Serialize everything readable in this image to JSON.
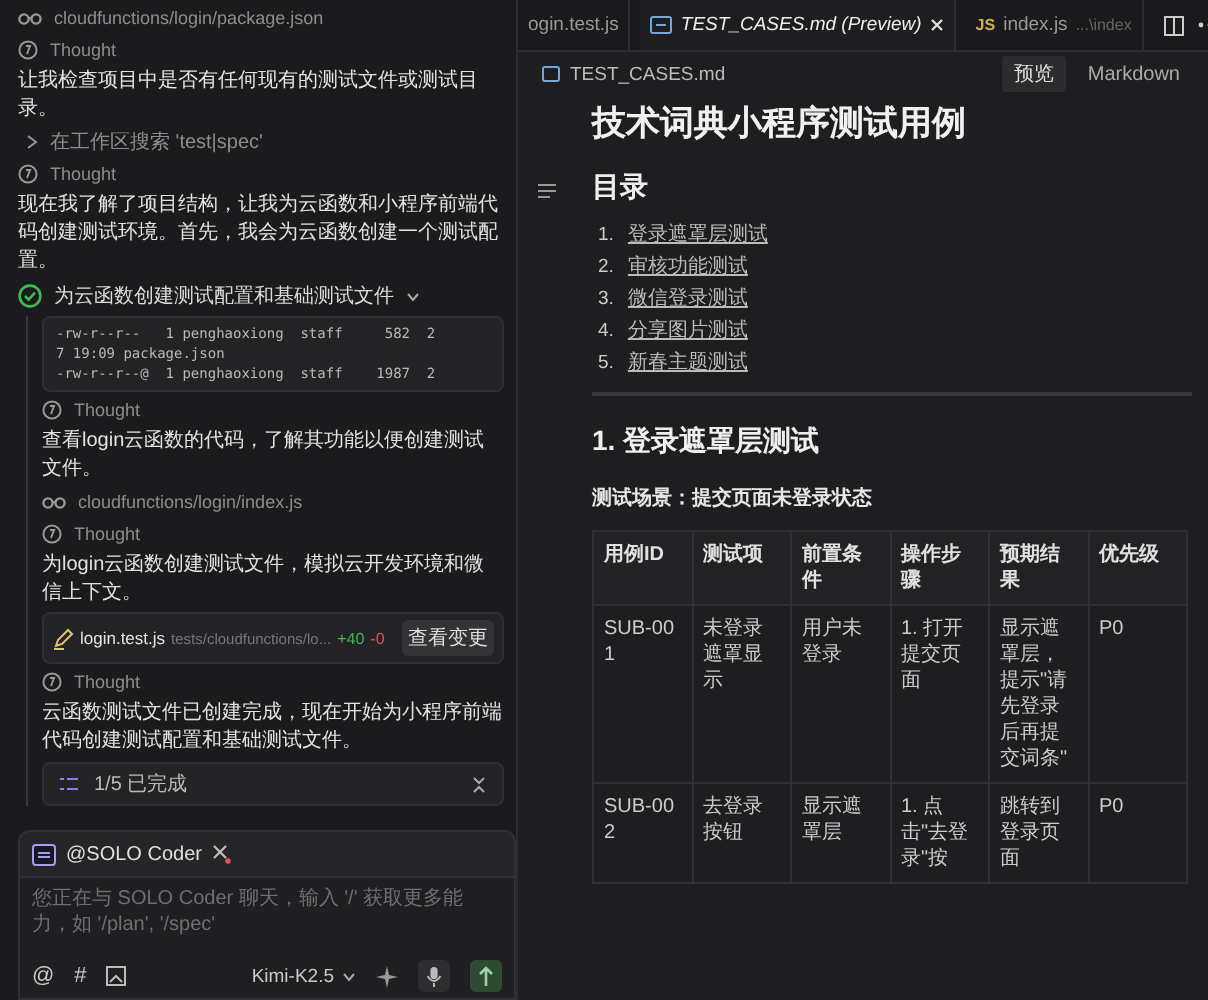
{
  "chat_panel": {
    "items": [
      {
        "kind": "file_read",
        "text": "cloudfunctions/login/package.json"
      },
      {
        "kind": "thought",
        "text": "Thought"
      },
      {
        "kind": "text",
        "text": "让我检查项目中是否有任何现有的测试文件或测试目录。"
      },
      {
        "kind": "search",
        "text": "在工作区搜索 'test|spec'",
        "expanded": false
      },
      {
        "kind": "thought",
        "text": "Thought"
      },
      {
        "kind": "text",
        "text": "现在我了解了项目结构，让我为云函数和小程序前端代码创建测试环境。首先，我会为云函数创建一个测试配置。"
      },
      {
        "kind": "task",
        "text": "为云函数创建测试配置和基础测试文件",
        "done": true,
        "expanded": true,
        "children": [
          {
            "kind": "terminal",
            "lines": [
              "-rw-r--r--   1 penghaoxiong  staff     582  2",
              "7 19:09 package.json",
              "-rw-r--r--@  1 penghaoxiong  staff    1987  2"
            ]
          },
          {
            "kind": "thought",
            "text": "Thought"
          },
          {
            "kind": "text",
            "text": "查看login云函数的代码，了解其功能以便创建测试文件。"
          },
          {
            "kind": "file_read",
            "text": "cloudfunctions/login/index.js"
          },
          {
            "kind": "thought",
            "text": "Thought"
          },
          {
            "kind": "text",
            "text": "为login云函数创建测试文件，模拟云开发环境和微信上下文。"
          },
          {
            "kind": "file_change",
            "name": "login.test.js",
            "path": "tests/cloudfunctions/lo...",
            "added": "+40",
            "removed": "-0",
            "button": "查看变更"
          },
          {
            "kind": "thought",
            "text": "Thought"
          },
          {
            "kind": "text",
            "text": "云函数测试文件已创建完成，现在开始为小程序前端代码创建测试配置和基础测试文件。"
          },
          {
            "kind": "progress",
            "text": "1/5 已完成"
          }
        ]
      }
    ],
    "composer": {
      "agent": "@SOLO Coder",
      "tool_glyphs": [
        "@",
        "#"
      ],
      "placeholder": "您正在与 SOLO Coder 聊天，输入 '/' 获取更多能力，如 '/plan', '/spec'",
      "model": "Kimi-K2.5"
    }
  },
  "editor": {
    "tabs": [
      {
        "kind": "plain",
        "label": "ogin.test.js",
        "selected": false
      },
      {
        "kind": "md",
        "label": "TEST_CASES.md (Preview)",
        "selected": true
      },
      {
        "kind": "js",
        "badge": "JS",
        "label": "index.js",
        "hint": "...\\index",
        "selected": false
      }
    ],
    "breadcrumb": "TEST_CASES.md",
    "view_buttons": [
      {
        "label": "预览",
        "selected": true
      },
      {
        "label": "Markdown",
        "selected": false
      }
    ],
    "document": {
      "title": "技术词典小程序测试用例",
      "toc_heading": "目录",
      "toc": [
        {
          "num": "1.",
          "text": "登录遮罩层测试"
        },
        {
          "num": "2.",
          "text": "审核功能测试"
        },
        {
          "num": "3.",
          "text": "微信登录测试"
        },
        {
          "num": "4.",
          "text": "分享图片测试"
        },
        {
          "num": "5.",
          "text": "新春主题测试"
        }
      ],
      "section_heading": "1. 登录遮罩层测试",
      "scenario": "测试场景：提交页面未登录状态",
      "table": {
        "columns": [
          "用例ID",
          "测试项",
          "前置条件",
          "操作步骤",
          "预期结果",
          "优先级"
        ],
        "rows": [
          [
            "SUB-001",
            "未登录遮罩显示",
            "用户未登录",
            "1. 打开提交页面",
            "显示遮罩层，提示\"请先登录后再提交词条\"",
            "P0"
          ],
          [
            "SUB-002",
            "去登录按钮",
            "显示遮罩层",
            "1. 点击\"去登录\"按",
            "跳转到登录页面",
            "P0"
          ]
        ]
      }
    }
  }
}
